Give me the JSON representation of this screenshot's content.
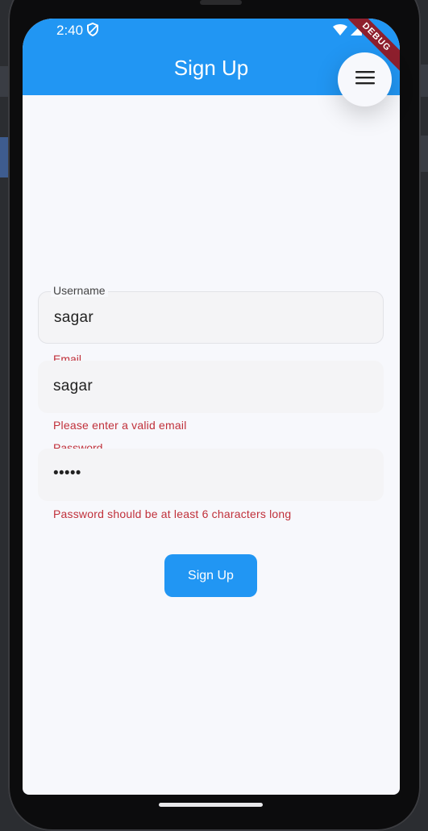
{
  "status_bar": {
    "time": "2:40"
  },
  "app_bar": {
    "title": "Sign Up",
    "debug_label": "DEBUG"
  },
  "form": {
    "username": {
      "label": "Username",
      "value": "sagar"
    },
    "email": {
      "label": "Email",
      "value": "sagar",
      "error": "Please enter a valid email"
    },
    "password": {
      "label": "Password",
      "value": "•••••",
      "error": "Password should be at least 6 characters long"
    },
    "submit_label": "Sign Up"
  },
  "colors": {
    "primary": "#2196f3",
    "error": "#c0303a",
    "background": "#f7f8fc"
  },
  "icons": [
    "shield-icon",
    "wifi-icon",
    "signal-icon",
    "battery-icon",
    "menu-icon"
  ]
}
